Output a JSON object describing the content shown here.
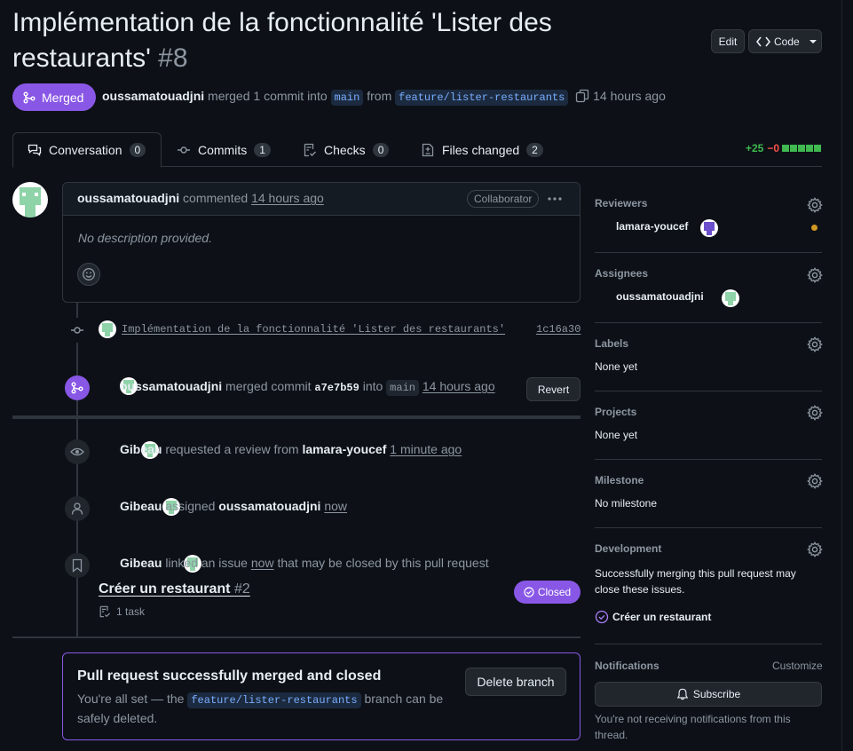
{
  "pr": {
    "title_line1": "Implémentation de la fonctionnalité 'Lister des",
    "title_line2": "restaurants'",
    "number": "#8",
    "state": "Merged",
    "author": "oussamatouadjni",
    "merged_text": "merged 1 commit into",
    "base_branch": "main",
    "from_text": "from",
    "head_branch": "feature/lister-restaurants",
    "time": "14 hours ago"
  },
  "header_buttons": {
    "edit": "Edit",
    "code": "Code"
  },
  "tabs": [
    {
      "label": "Conversation",
      "count": "0"
    },
    {
      "label": "Commits",
      "count": "1"
    },
    {
      "label": "Checks",
      "count": "0"
    },
    {
      "label": "Files changed",
      "count": "2"
    }
  ],
  "diffstat": {
    "added": "+25",
    "removed": "−0"
  },
  "comment": {
    "author": "oussamatouadjni",
    "action": "commented",
    "time": "14 hours ago",
    "badge": "Collaborator",
    "body": "No description provided."
  },
  "commit": {
    "message": "Implémentation de la fonctionnalité 'Lister des restaurants'",
    "sha": "1c16a30"
  },
  "merge_event": {
    "author": "oussamatouadjni",
    "text1": "merged commit",
    "sha": "a7e7b59",
    "text2": "into",
    "branch": "main",
    "time": "14 hours ago",
    "revert": "Revert"
  },
  "review_event": {
    "actor": "Gibeau",
    "text": "requested a review from",
    "reviewer": "lamara-youcef",
    "time": "1 minute ago"
  },
  "assign_event": {
    "actor": "Gibeau",
    "text": "assigned",
    "assignee": "oussamatouadjni",
    "time": "now"
  },
  "link_event": {
    "actor": "Gibeau",
    "text1": "linked an issue",
    "time": "now",
    "text2": "that may be closed by this pull request",
    "issue_title": "Créer un restaurant",
    "issue_number": "#2",
    "tasks": "1 task",
    "issue_state": "Closed"
  },
  "merged_box": {
    "title": "Pull request successfully merged and closed",
    "text1": "You're all set — the",
    "branch": "feature/lister-restaurants",
    "text2": "branch can be",
    "text3": "safely deleted.",
    "delete_button": "Delete branch"
  },
  "sidebar": {
    "reviewers": {
      "title": "Reviewers",
      "value": "lamara-youcef"
    },
    "assignees": {
      "title": "Assignees",
      "value": "oussamatouadjni"
    },
    "labels": {
      "title": "Labels",
      "value": "None yet"
    },
    "projects": {
      "title": "Projects",
      "value": "None yet"
    },
    "milestone": {
      "title": "Milestone",
      "value": "No milestone"
    },
    "development": {
      "title": "Development",
      "text_line1": "Successfully merging this pull request may",
      "text_line2": "close these issues.",
      "issue": "Créer un restaurant"
    },
    "notifications": {
      "title": "Notifications",
      "customize": "Customize",
      "subscribe": "Subscribe",
      "note_line1": "You're not receiving notifications from this",
      "note_line2": "thread."
    }
  },
  "colors": {
    "merged": "#8957e5",
    "accent": "#4493f8",
    "added": "#3fb950",
    "removed": "#f85149"
  }
}
